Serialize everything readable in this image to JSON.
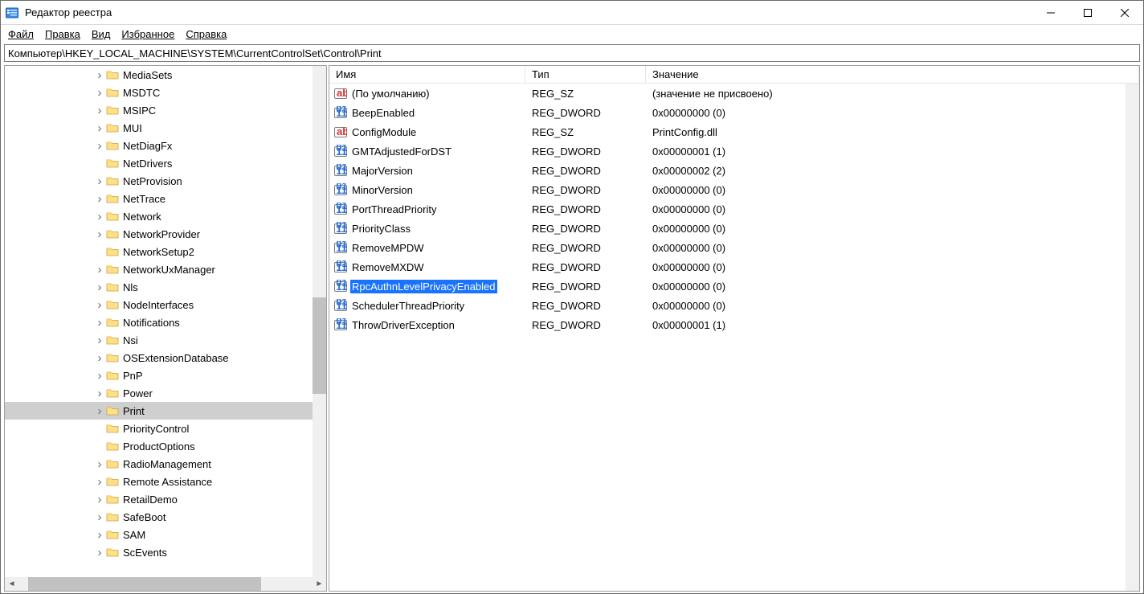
{
  "window": {
    "title": "Редактор реестра"
  },
  "menu": {
    "file": "Файл",
    "edit": "Правка",
    "view": "Вид",
    "favorites": "Избранное",
    "help": "Справка"
  },
  "path": "Компьютер\\HKEY_LOCAL_MACHINE\\SYSTEM\\CurrentControlSet\\Control\\Print",
  "tree": {
    "items": [
      {
        "label": "MediaSets",
        "expandable": true,
        "indent": 190
      },
      {
        "label": "MSDTC",
        "expandable": true,
        "indent": 190
      },
      {
        "label": "MSIPC",
        "expandable": true,
        "indent": 190
      },
      {
        "label": "MUI",
        "expandable": true,
        "indent": 190
      },
      {
        "label": "NetDiagFx",
        "expandable": true,
        "indent": 190
      },
      {
        "label": "NetDrivers",
        "expandable": false,
        "indent": 190
      },
      {
        "label": "NetProvision",
        "expandable": true,
        "indent": 190
      },
      {
        "label": "NetTrace",
        "expandable": true,
        "indent": 190
      },
      {
        "label": "Network",
        "expandable": true,
        "indent": 190
      },
      {
        "label": "NetworkProvider",
        "expandable": true,
        "indent": 190
      },
      {
        "label": "NetworkSetup2",
        "expandable": false,
        "indent": 190
      },
      {
        "label": "NetworkUxManager",
        "expandable": true,
        "indent": 190
      },
      {
        "label": "Nls",
        "expandable": true,
        "indent": 190
      },
      {
        "label": "NodeInterfaces",
        "expandable": true,
        "indent": 190
      },
      {
        "label": "Notifications",
        "expandable": true,
        "indent": 190
      },
      {
        "label": "Nsi",
        "expandable": true,
        "indent": 190
      },
      {
        "label": "OSExtensionDatabase",
        "expandable": true,
        "indent": 190
      },
      {
        "label": "PnP",
        "expandable": true,
        "indent": 190
      },
      {
        "label": "Power",
        "expandable": true,
        "indent": 190
      },
      {
        "label": "Print",
        "expandable": true,
        "indent": 190,
        "selected": true
      },
      {
        "label": "PriorityControl",
        "expandable": false,
        "indent": 190
      },
      {
        "label": "ProductOptions",
        "expandable": false,
        "indent": 190
      },
      {
        "label": "RadioManagement",
        "expandable": true,
        "indent": 190
      },
      {
        "label": "Remote Assistance",
        "expandable": true,
        "indent": 190
      },
      {
        "label": "RetailDemo",
        "expandable": true,
        "indent": 190
      },
      {
        "label": "SafeBoot",
        "expandable": true,
        "indent": 190
      },
      {
        "label": "SAM",
        "expandable": true,
        "indent": 190
      },
      {
        "label": "ScEvents",
        "expandable": true,
        "indent": 190
      }
    ]
  },
  "columns": {
    "name": "Имя",
    "type": "Тип",
    "value": "Значение"
  },
  "values": [
    {
      "icon": "sz",
      "name": "(По умолчанию)",
      "type": "REG_SZ",
      "value": "(значение не присвоено)"
    },
    {
      "icon": "bin",
      "name": "BeepEnabled",
      "type": "REG_DWORD",
      "value": "0x00000000 (0)"
    },
    {
      "icon": "sz",
      "name": "ConfigModule",
      "type": "REG_SZ",
      "value": "PrintConfig.dll"
    },
    {
      "icon": "bin",
      "name": "GMTAdjustedForDST",
      "type": "REG_DWORD",
      "value": "0x00000001 (1)"
    },
    {
      "icon": "bin",
      "name": "MajorVersion",
      "type": "REG_DWORD",
      "value": "0x00000002 (2)"
    },
    {
      "icon": "bin",
      "name": "MinorVersion",
      "type": "REG_DWORD",
      "value": "0x00000000 (0)"
    },
    {
      "icon": "bin",
      "name": "PortThreadPriority",
      "type": "REG_DWORD",
      "value": "0x00000000 (0)"
    },
    {
      "icon": "bin",
      "name": "PriorityClass",
      "type": "REG_DWORD",
      "value": "0x00000000 (0)"
    },
    {
      "icon": "bin",
      "name": "RemoveMPDW",
      "type": "REG_DWORD",
      "value": "0x00000000 (0)"
    },
    {
      "icon": "bin",
      "name": "RemoveMXDW",
      "type": "REG_DWORD",
      "value": "0x00000000 (0)"
    },
    {
      "icon": "bin",
      "name": "RpcAuthnLevelPrivacyEnabled",
      "type": "REG_DWORD",
      "value": "0x00000000 (0)",
      "selected": true
    },
    {
      "icon": "bin",
      "name": "SchedulerThreadPriority",
      "type": "REG_DWORD",
      "value": "0x00000000 (0)"
    },
    {
      "icon": "bin",
      "name": "ThrowDriverException",
      "type": "REG_DWORD",
      "value": "0x00000001 (1)"
    }
  ]
}
